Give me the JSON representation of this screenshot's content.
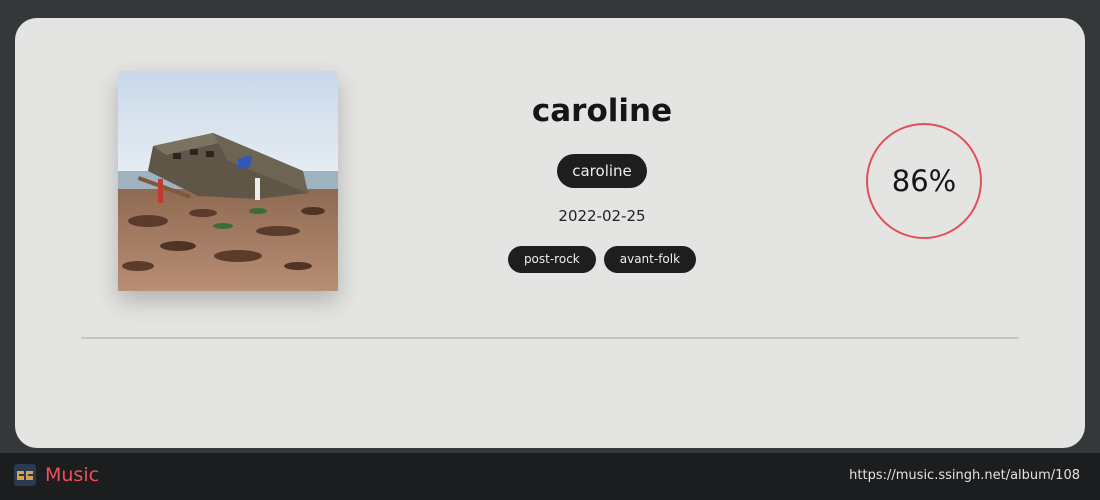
{
  "album": {
    "title": "caroline",
    "artist": "caroline",
    "release_date": "2022-02-25",
    "tags": [
      "post-rock",
      "avant-folk"
    ],
    "score": "86%",
    "score_color": "#e0505a"
  },
  "footer": {
    "brand": "Music",
    "url": "https://music.ssingh.net/album/108",
    "brand_color": "#ef5058"
  },
  "cover": {
    "alt": "album cover: concrete bunker tilted on a muddy beach"
  }
}
